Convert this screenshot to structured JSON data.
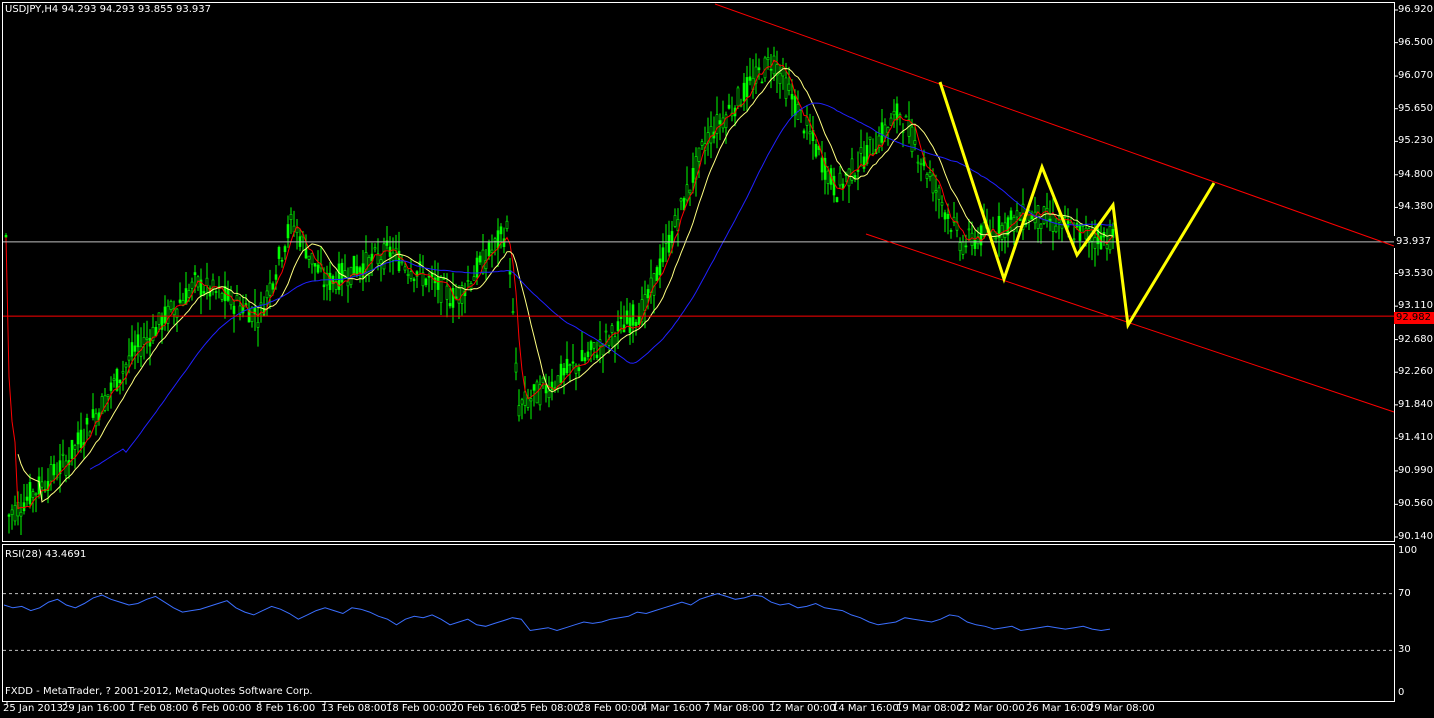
{
  "header": {
    "symbol_line": "USDJPY,H4  94.293 94.293 93.855 93.937"
  },
  "indicator": {
    "label": "RSI(28) 43.4691",
    "levels": [
      "100",
      "70",
      "30",
      "0"
    ]
  },
  "footer": {
    "copyright": "FXDD - MetaTrader, ? 2001-2012, MetaQuotes Software Corp."
  },
  "price_axis": [
    "96.920",
    "96.500",
    "96.070",
    "95.650",
    "95.230",
    "94.800",
    "94.380",
    "93.937",
    "93.530",
    "93.110",
    "92.680",
    "92.260",
    "91.840",
    "91.410",
    "90.990",
    "90.560",
    "90.140"
  ],
  "current_price_label": "93.937",
  "red_level_label": "92.982",
  "time_axis": [
    "25 Jan 2013",
    "29 Jan 16:00",
    "1 Feb 08:00",
    "6 Feb 00:00",
    "8 Feb 16:00",
    "13 Feb 08:00",
    "18 Feb 00:00",
    "20 Feb 16:00",
    "25 Feb 08:00",
    "28 Feb 00:00",
    "4 Mar 16:00",
    "7 Mar 08:00",
    "12 Mar 00:00",
    "14 Mar 16:00",
    "19 Mar 08:00",
    "22 Mar 00:00",
    "26 Mar 16:00",
    "29 Mar 08:00"
  ],
  "colors": {
    "background": "#000000",
    "candles": "#00ff00",
    "ma_fast": "#ff0000",
    "ma_mid": "#ffff80",
    "ma_slow": "#2020ff",
    "channel": "#ff0000",
    "zigzag": "#ffff00",
    "rsi": "#3b6fff",
    "price_line": "#c0c0c0"
  },
  "chart_data": [
    {
      "type": "candlestick",
      "title": "USDJPY,H4",
      "ohlc_last": {
        "open": 94.293,
        "high": 94.293,
        "low": 93.855,
        "close": 93.937
      },
      "ylim": [
        90.14,
        96.92
      ],
      "x_range": [
        "25 Jan 2013",
        "29 Mar 08:00"
      ],
      "close_path": [
        [
          "25 Jan 2013",
          90.4
        ],
        [
          "29 Jan 16:00",
          91.1
        ],
        [
          "1 Feb 08:00",
          92.5
        ],
        [
          "6 Feb 00:00",
          93.4
        ],
        [
          "8 Feb 16:00",
          93.0
        ],
        [
          "10 Feb 00:00",
          94.2
        ],
        [
          "13 Feb 08:00",
          93.4
        ],
        [
          "18 Feb 00:00",
          93.8
        ],
        [
          "20 Feb 16:00",
          93.2
        ],
        [
          "22 Feb 08:00",
          94.1
        ],
        [
          "25 Feb 08:00",
          91.8
        ],
        [
          "28 Feb 00:00",
          92.4
        ],
        [
          "4 Mar 16:00",
          93.1
        ],
        [
          "7 Mar 08:00",
          95.3
        ],
        [
          "12 Mar 00:00",
          96.3
        ],
        [
          "14 Mar 16:00",
          94.6
        ],
        [
          "19 Mar 08:00",
          95.6
        ],
        [
          "22 Mar 00:00",
          93.9
        ],
        [
          "26 Mar 16:00",
          94.3
        ],
        [
          "29 Mar 08:00",
          94.0
        ]
      ],
      "horizontal_lines": [
        {
          "value": 93.937,
          "label": "93.937"
        },
        {
          "value": 92.982,
          "label": "92.982"
        }
      ],
      "channel": {
        "upper": [
          [
            "5 Mar 00:00",
            96.92
          ],
          [
            "29 Mar 08:00",
            94.77
          ],
          [
            "projection",
            93.9
          ]
        ],
        "lower": [
          [
            "14 Mar 16:00",
            94.05
          ],
          [
            "29 Mar 08:00",
            92.97
          ],
          [
            "projection",
            91.76
          ]
        ]
      },
      "zigzag": [
        [
          "19 Mar 08:00",
          96.07
        ],
        [
          "22 Mar 00:00",
          93.55
        ],
        [
          "26 Mar 16:00",
          94.93
        ],
        [
          "28 Mar 00:00",
          93.8
        ],
        [
          "29 Mar 08:00",
          94.42
        ],
        [
          "30 Mar 00:00",
          92.95
        ],
        [
          "projection",
          94.75
        ]
      ]
    },
    {
      "type": "line",
      "title": "RSI(28) 43.4691",
      "ylim": [
        0,
        100
      ],
      "levels": [
        70,
        30
      ],
      "values": [
        62,
        60,
        61,
        58,
        60,
        64,
        66,
        62,
        60,
        63,
        67,
        69,
        66,
        64,
        62,
        63,
        66,
        68,
        64,
        60,
        57,
        58,
        59,
        61,
        63,
        65,
        60,
        57,
        55,
        58,
        61,
        59,
        56,
        52,
        55,
        58,
        60,
        58,
        56,
        60,
        59,
        57,
        54,
        52,
        48,
        52,
        54,
        53,
        55,
        52,
        48,
        50,
        52,
        48,
        47,
        49,
        51,
        53,
        52,
        44,
        45,
        46,
        44,
        46,
        48,
        50,
        49,
        50,
        52,
        53,
        54,
        57,
        56,
        58,
        60,
        62,
        64,
        62,
        66,
        68,
        70,
        68,
        66,
        67,
        69,
        68,
        64,
        62,
        63,
        60,
        61,
        63,
        60,
        59,
        58,
        55,
        53,
        50,
        48,
        49,
        50,
        53,
        52,
        51,
        50,
        52,
        55,
        54,
        50,
        48,
        47,
        45,
        46,
        47,
        44,
        45,
        46,
        47,
        46,
        45,
        46,
        47,
        45,
        44,
        45
      ]
    }
  ]
}
